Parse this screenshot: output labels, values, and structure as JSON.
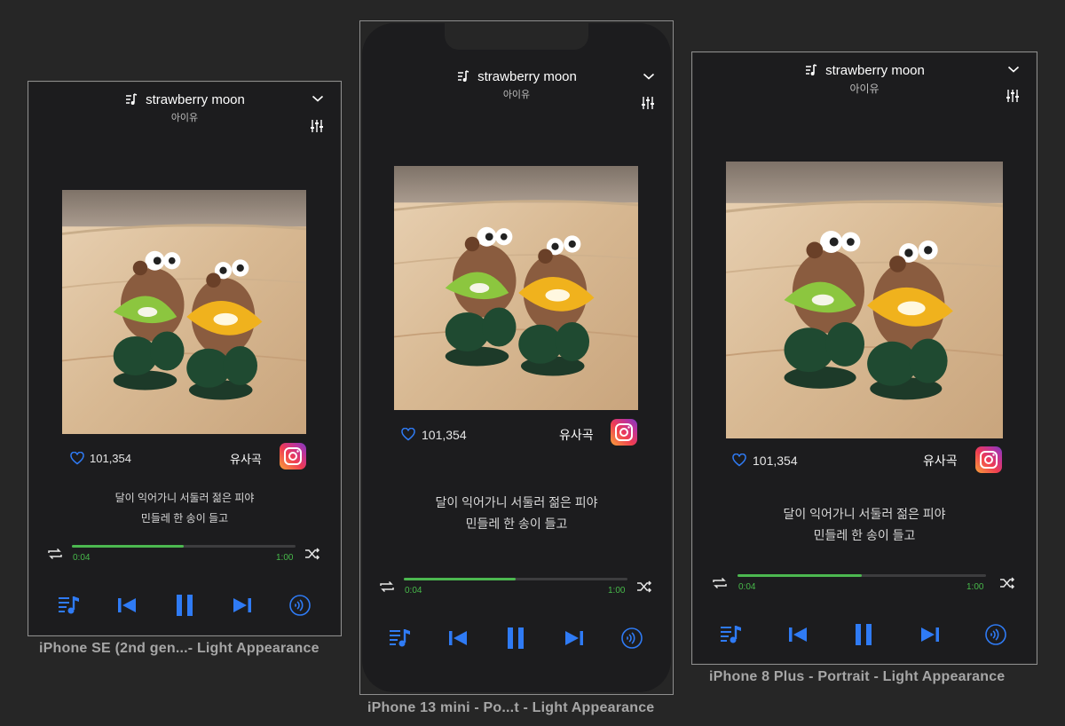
{
  "devices": [
    {
      "name": "iPhone SE (2nd gen...- Light Appearance"
    },
    {
      "name": "iPhone 13 mini - Po...t - Light Appearance"
    },
    {
      "name": "iPhone 8 Plus - Portrait - Light Appearance"
    }
  ],
  "player": {
    "title": "strawberry moon",
    "artist": "아이유",
    "likes": "101,354",
    "similar_label": "유사곡",
    "lyric_line1": "달이 익어가니 서둘러 젊은 피야",
    "lyric_line2": "민들레 한 송이 들고",
    "time_elapsed": "0:04",
    "time_total": "1:00",
    "progress": 0.5
  },
  "colors": {
    "accent": "#2f7bf5",
    "progress": "#4cb850",
    "background": "#1c1c1e"
  },
  "icons": [
    "music-note-icon",
    "chevron-down-icon",
    "equalizer-icon",
    "heart-icon",
    "instagram-icon",
    "repeat-icon",
    "shuffle-icon",
    "playlist-icon",
    "previous-icon",
    "pause-icon",
    "next-icon",
    "wireless-icon"
  ],
  "album_art": "photo of two kiwi-fruit character toys on a wooden table"
}
